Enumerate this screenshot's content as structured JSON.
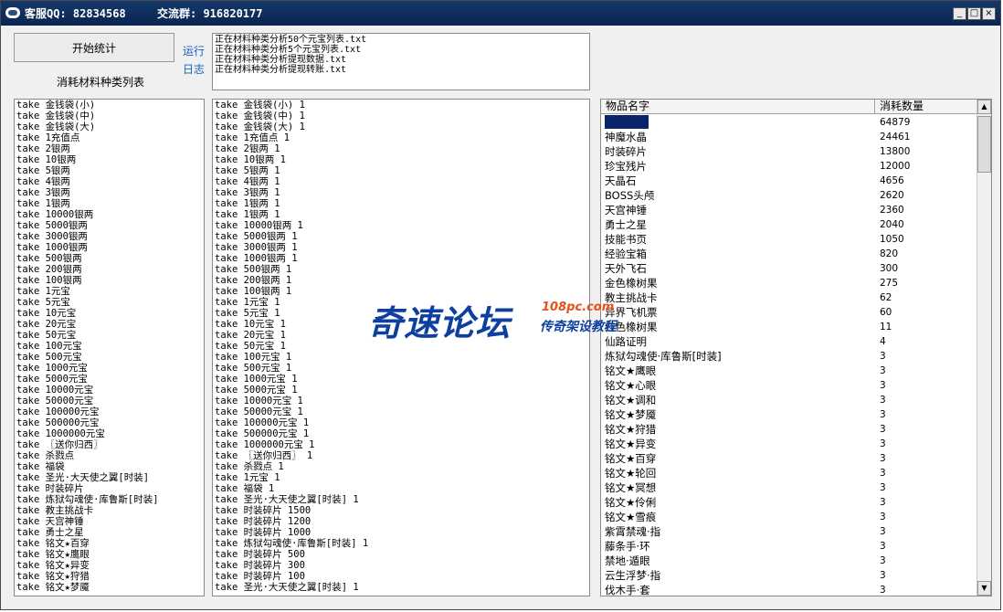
{
  "titlebar": {
    "service": "客服QQ: 82834568",
    "group": "交流群: 916820177",
    "minimize": "_",
    "maximize": "□",
    "close": "×"
  },
  "controls": {
    "start_button": "开始统计",
    "list_label": "消耗材料种类列表",
    "run_label": "运行",
    "log_label": "日志"
  },
  "log_lines": [
    "正在材料种类分析50个元宝列表.txt",
    "正在材料种类分析5个元宝列表.txt",
    "正在材料种类分析提现数据.txt",
    "正在材料种类分析提现转账.txt"
  ],
  "left_list": [
    "take 金钱袋(小)",
    "take 金钱袋(中)",
    "take 金钱袋(大)",
    "take 1充值点",
    "take 2银两",
    "take 10银两",
    "take 5银两",
    "take 4银两",
    "take 3银两",
    "take 1银两",
    "take 10000银两",
    "take 5000银两",
    "take 3000银两",
    "take 1000银两",
    "take 500银两",
    "take 200银两",
    "take 100银两",
    "take 1元宝",
    "take 5元宝",
    "take 10元宝",
    "take 20元宝",
    "take 50元宝",
    "take 100元宝",
    "take 500元宝",
    "take 1000元宝",
    "take 5000元宝",
    "take 10000元宝",
    "take 50000元宝",
    "take 100000元宝",
    "take 500000元宝",
    "take 1000000元宝",
    "take 〖送你归西〗",
    "take 杀戮点",
    "take 福袋",
    "take 圣光·大天使之翼[时装]",
    "take 时装碎片",
    "take 炼狱勾魂使·库鲁斯[时装]",
    "take 教主挑战卡",
    "take 天宫神锤",
    "take 勇士之星",
    "take 铭文★百穿",
    "take 铭文★鹰眼",
    "take 铭文★异变",
    "take 铭文★狩猎",
    "take 铭文★梦魇"
  ],
  "middle_list": [
    "take 金钱袋(小) 1",
    "take 金钱袋(中) 1",
    "take 金钱袋(大) 1",
    "take 1充值点 1",
    "take 2银两 1",
    "take 10银两 1",
    "take 5银两 1",
    "take 4银两 1",
    "take 3银两 1",
    "take 1银两 1",
    "take 1银两 1",
    "take 10000银两 1",
    "take 5000银两 1",
    "take 3000银两 1",
    "take 1000银两 1",
    "take 500银两 1",
    "take 200银两 1",
    "take 100银两 1",
    "take 1元宝 1",
    "take 5元宝 1",
    "take 10元宝 1",
    "take 20元宝 1",
    "take 50元宝 1",
    "take 100元宝 1",
    "take 500元宝 1",
    "take 1000元宝 1",
    "take 5000元宝 1",
    "take 10000元宝 1",
    "take 50000元宝 1",
    "take 100000元宝 1",
    "take 500000元宝 1",
    "take 1000000元宝 1",
    "take 〖送你归西〗 1",
    "take 杀戮点 1",
    "take 1元宝 1",
    "take 福袋 1",
    "take 圣光·大天使之翼[时装] 1",
    "take 时装碎片 1500",
    "take 时装碎片 1200",
    "take 时装碎片 1000",
    "take 炼狱勾魂使·库鲁斯[时装] 1",
    "take 时装碎片 500",
    "take 时装碎片 300",
    "take 时装碎片 100",
    "take 圣光·大天使之翼[时装] 1"
  ],
  "grid": {
    "col_name": "物品名字",
    "col_qty": "消耗数量",
    "rows": [
      {
        "name": "",
        "qty": "64879"
      },
      {
        "name": "神魔水晶",
        "qty": "24461"
      },
      {
        "name": "时装碎片",
        "qty": "13800"
      },
      {
        "name": "珍宝残片",
        "qty": "12000"
      },
      {
        "name": "天晶石",
        "qty": "4656"
      },
      {
        "name": "BOSS头颅",
        "qty": "2620"
      },
      {
        "name": "天宫神锤",
        "qty": "2360"
      },
      {
        "name": "勇士之星",
        "qty": "2040"
      },
      {
        "name": "技能书页",
        "qty": "1050"
      },
      {
        "name": "经验宝箱",
        "qty": "820"
      },
      {
        "name": "天外飞石",
        "qty": "300"
      },
      {
        "name": "金色橡树果",
        "qty": "275"
      },
      {
        "name": "教主挑战卡",
        "qty": "62"
      },
      {
        "name": "异界飞机票",
        "qty": "60"
      },
      {
        "name": "红色橡树果",
        "qty": "11"
      },
      {
        "name": "仙路证明",
        "qty": "4"
      },
      {
        "name": "炼狱勾魂使·库鲁斯[时装]",
        "qty": "3"
      },
      {
        "name": "铭文★鹰眼",
        "qty": "3"
      },
      {
        "name": "铭文★心眼",
        "qty": "3"
      },
      {
        "name": "铭文★调和",
        "qty": "3"
      },
      {
        "name": "铭文★梦魇",
        "qty": "3"
      },
      {
        "name": "铭文★狩猎",
        "qty": "3"
      },
      {
        "name": "铭文★异变",
        "qty": "3"
      },
      {
        "name": "铭文★百穿",
        "qty": "3"
      },
      {
        "name": "铭文★轮回",
        "qty": "3"
      },
      {
        "name": "铭文★冥想",
        "qty": "3"
      },
      {
        "name": "铭文★伶俐",
        "qty": "3"
      },
      {
        "name": "铭文★雪痕",
        "qty": "3"
      },
      {
        "name": "紫霄禁魂·指",
        "qty": "3"
      },
      {
        "name": "藤条手·环",
        "qty": "3"
      },
      {
        "name": "禁地·遁眼",
        "qty": "3"
      },
      {
        "name": "云生浮梦·指",
        "qty": "3"
      },
      {
        "name": "伐木手·套",
        "qty": "3"
      }
    ]
  },
  "watermark": {
    "main": "奇速论坛",
    "domain": "108pc.com",
    "sub": "传奇架设教程"
  },
  "colors": {
    "titlebar": "#0a2450",
    "selection": "#0a246a",
    "link_blue": "#1560c8",
    "watermark_blue": "#0d3fa0",
    "watermark_orange": "#e8501a"
  }
}
